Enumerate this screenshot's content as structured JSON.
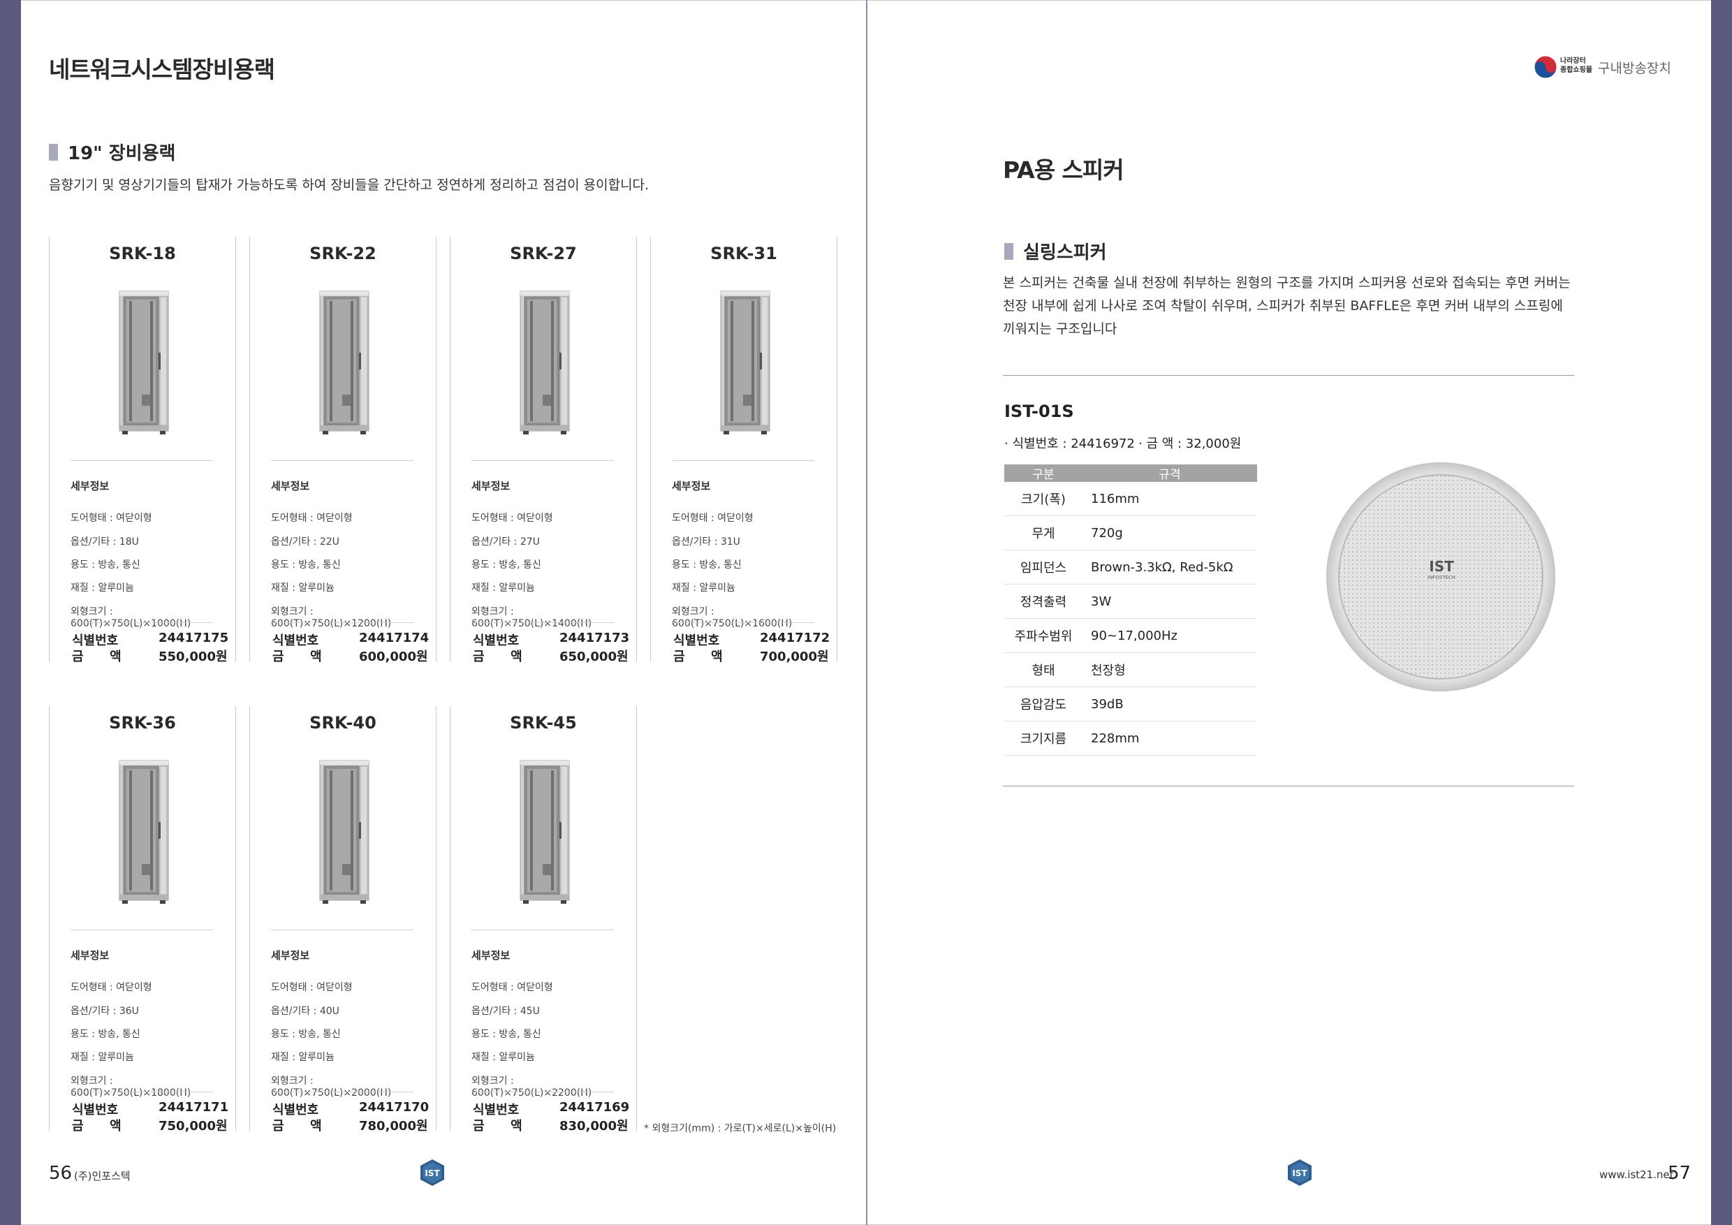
{
  "left": {
    "title": "네트워크시스템장비용랙",
    "section_title": "19\" 장비용랙",
    "description": "음향기기 및 영상기기들의 탑재가 가능하도록 하여 장비들을 간단하고 정연하게 정리하고 점검이 용이합니다.",
    "detail_heading": "세부정보",
    "id_label": "식별번호",
    "price_label": "금      액",
    "products": [
      {
        "name": "SRK-18",
        "door": "도어형태 : 여닫이형",
        "option": "옵션/기타 : 18U",
        "use": "용도 : 방송, 통신",
        "material": "재질 : 알루미늄",
        "size": "외형크기 : 600(T)×750(L)×1000(H)",
        "id": "24417175",
        "price": "550,000원"
      },
      {
        "name": "SRK-22",
        "door": "도어형태 : 여닫이형",
        "option": "옵션/기타 : 22U",
        "use": "용도 : 방송, 통신",
        "material": "재질 : 알루미늄",
        "size": "외형크기 : 600(T)×750(L)×1200(H)",
        "id": "24417174",
        "price": "600,000원"
      },
      {
        "name": "SRK-27",
        "door": "도어형태 : 여닫이형",
        "option": "옵션/기타 : 27U",
        "use": "용도 : 방송, 통신",
        "material": "재질 : 알루미늄",
        "size": "외형크기 : 600(T)×750(L)×1400(H)",
        "id": "24417173",
        "price": "650,000원"
      },
      {
        "name": "SRK-31",
        "door": "도어형태 : 여닫이형",
        "option": "옵션/기타 : 31U",
        "use": "용도 : 방송, 통신",
        "material": "재질 : 알루미늄",
        "size": "외형크기 : 600(T)×750(L)×1600(H)",
        "id": "24417172",
        "price": "700,000원"
      },
      {
        "name": "SRK-36",
        "door": "도어형태 : 여닫이형",
        "option": "옵션/기타 : 36U",
        "use": "용도 : 방송, 통신",
        "material": "재질 : 알루미늄",
        "size": "외형크기 : 600(T)×750(L)×1800(H)",
        "id": "24417171",
        "price": "750,000원"
      },
      {
        "name": "SRK-40",
        "door": "도어형태 : 여닫이형",
        "option": "옵션/기타 : 40U",
        "use": "용도 : 방송, 통신",
        "material": "재질 : 알루미늄",
        "size": "외형크기 : 600(T)×750(L)×2000(H)",
        "id": "24417170",
        "price": "780,000원"
      },
      {
        "name": "SRK-45",
        "door": "도어형태 : 여닫이형",
        "option": "옵션/기타 : 45U",
        "use": "용도 : 방송, 통신",
        "material": "재질 : 알루미늄",
        "size": "외형크기 : 600(T)×750(L)×2200(H)",
        "id": "24417169",
        "price": "830,000원"
      }
    ],
    "footnote": "* 외형크기(mm) : 가로(T)×세로(L)×높이(H)",
    "page_number": "56",
    "company": "(주)인포스텍"
  },
  "right": {
    "header_badge_line1": "나라장터",
    "header_badge_line2": "종합쇼핑몰",
    "header_category": "구내방송장치",
    "title": "PA용 스피커",
    "section_title": "실링스피커",
    "description_lines": [
      "본 스피커는 건축물 실내 천장에 취부하는 원형의 구조를 가지며 스피커용 선로와 접속되는 후면 커버는",
      "천장 내부에 쉽게 나사로 조여 착탈이 쉬우며, 스피커가 취부된 BAFFLE은 후면 커버 내부의 스프링에",
      "끼워지는 구조입니다"
    ],
    "model": "IST-01S",
    "id_text": "· 식별번호 : 24416972",
    "price_text": "· 금    액 : 32,000원",
    "table_headers": [
      "구분",
      "규격"
    ],
    "table_rows": [
      {
        "k": "크기(폭)",
        "v": "116mm"
      },
      {
        "k": "무게",
        "v": "720g"
      },
      {
        "k": "임피던스",
        "v": "Brown-3.3kΩ, Red-5kΩ"
      },
      {
        "k": "정격출력",
        "v": "3W"
      },
      {
        "k": "주파수범위",
        "v": "90~17,000Hz"
      },
      {
        "k": "형태",
        "v": "천장형"
      },
      {
        "k": "음압감도",
        "v": "39dB"
      },
      {
        "k": "크기지름",
        "v": "228mm"
      }
    ],
    "speaker_logo": "IST",
    "speaker_logo_sub": "INFOSTECH",
    "website": "www.ist21.net",
    "page_number": "57"
  },
  "colors": {
    "accent_bar": "#a8a8bc",
    "table_header": "#a3a3a3",
    "page_edge": "#5a5a7e",
    "logo_blue": "#2f5f8f"
  }
}
